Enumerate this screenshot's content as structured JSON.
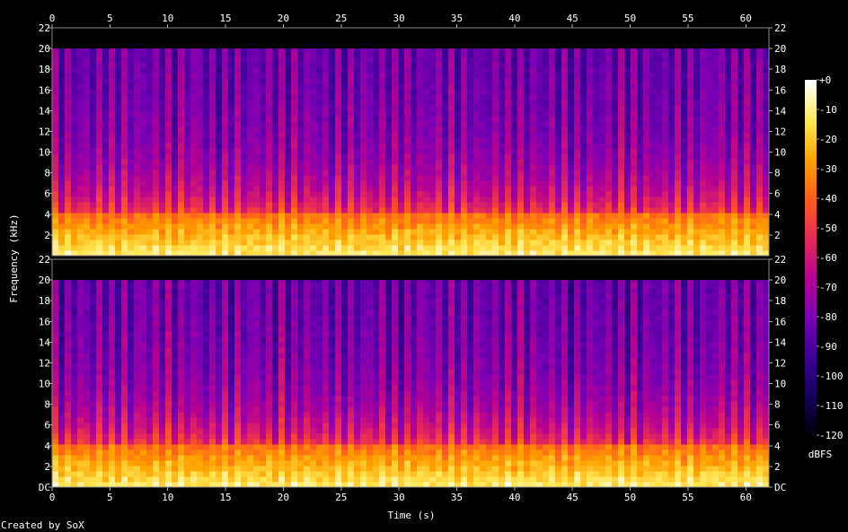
{
  "chart_data": {
    "type": "heatmap",
    "channels": 2,
    "xlabel": "Time (s)",
    "ylabel": "Frequency (kHz)",
    "x_ticks": [
      0,
      5,
      10,
      15,
      20,
      25,
      30,
      35,
      40,
      45,
      50,
      55,
      60
    ],
    "xlim": [
      0,
      62
    ],
    "ylim": [
      0,
      22
    ],
    "y_ticks_top_channel": [
      "2",
      "4",
      "6",
      "8",
      "10",
      "12",
      "14",
      "16",
      "18",
      "20",
      "22"
    ],
    "y_ticks_bottom_channel": [
      "DC",
      "2",
      "4",
      "6",
      "8",
      "10",
      "12",
      "14",
      "16",
      "18",
      "20",
      "22"
    ],
    "bottom_channel_base_label": "DC",
    "colorbar": {
      "unit": "dBFS",
      "ticks": [
        "+0",
        "-10",
        "-20",
        "-30",
        "-40",
        "-50",
        "-60",
        "-70",
        "-80",
        "-90",
        "-100",
        "-110",
        "-120"
      ],
      "range": [
        -120,
        0
      ],
      "colors": [
        "#000000",
        "#14005a",
        "#3c0096",
        "#7800b4",
        "#b40096",
        "#e6285a",
        "#ff5a1e",
        "#ffa000",
        "#ffe650",
        "#ffffff"
      ]
    },
    "signal_cutoff_khz": 20,
    "loud_band_khz": 4
  },
  "footer": {
    "credit": "Created by SoX"
  }
}
